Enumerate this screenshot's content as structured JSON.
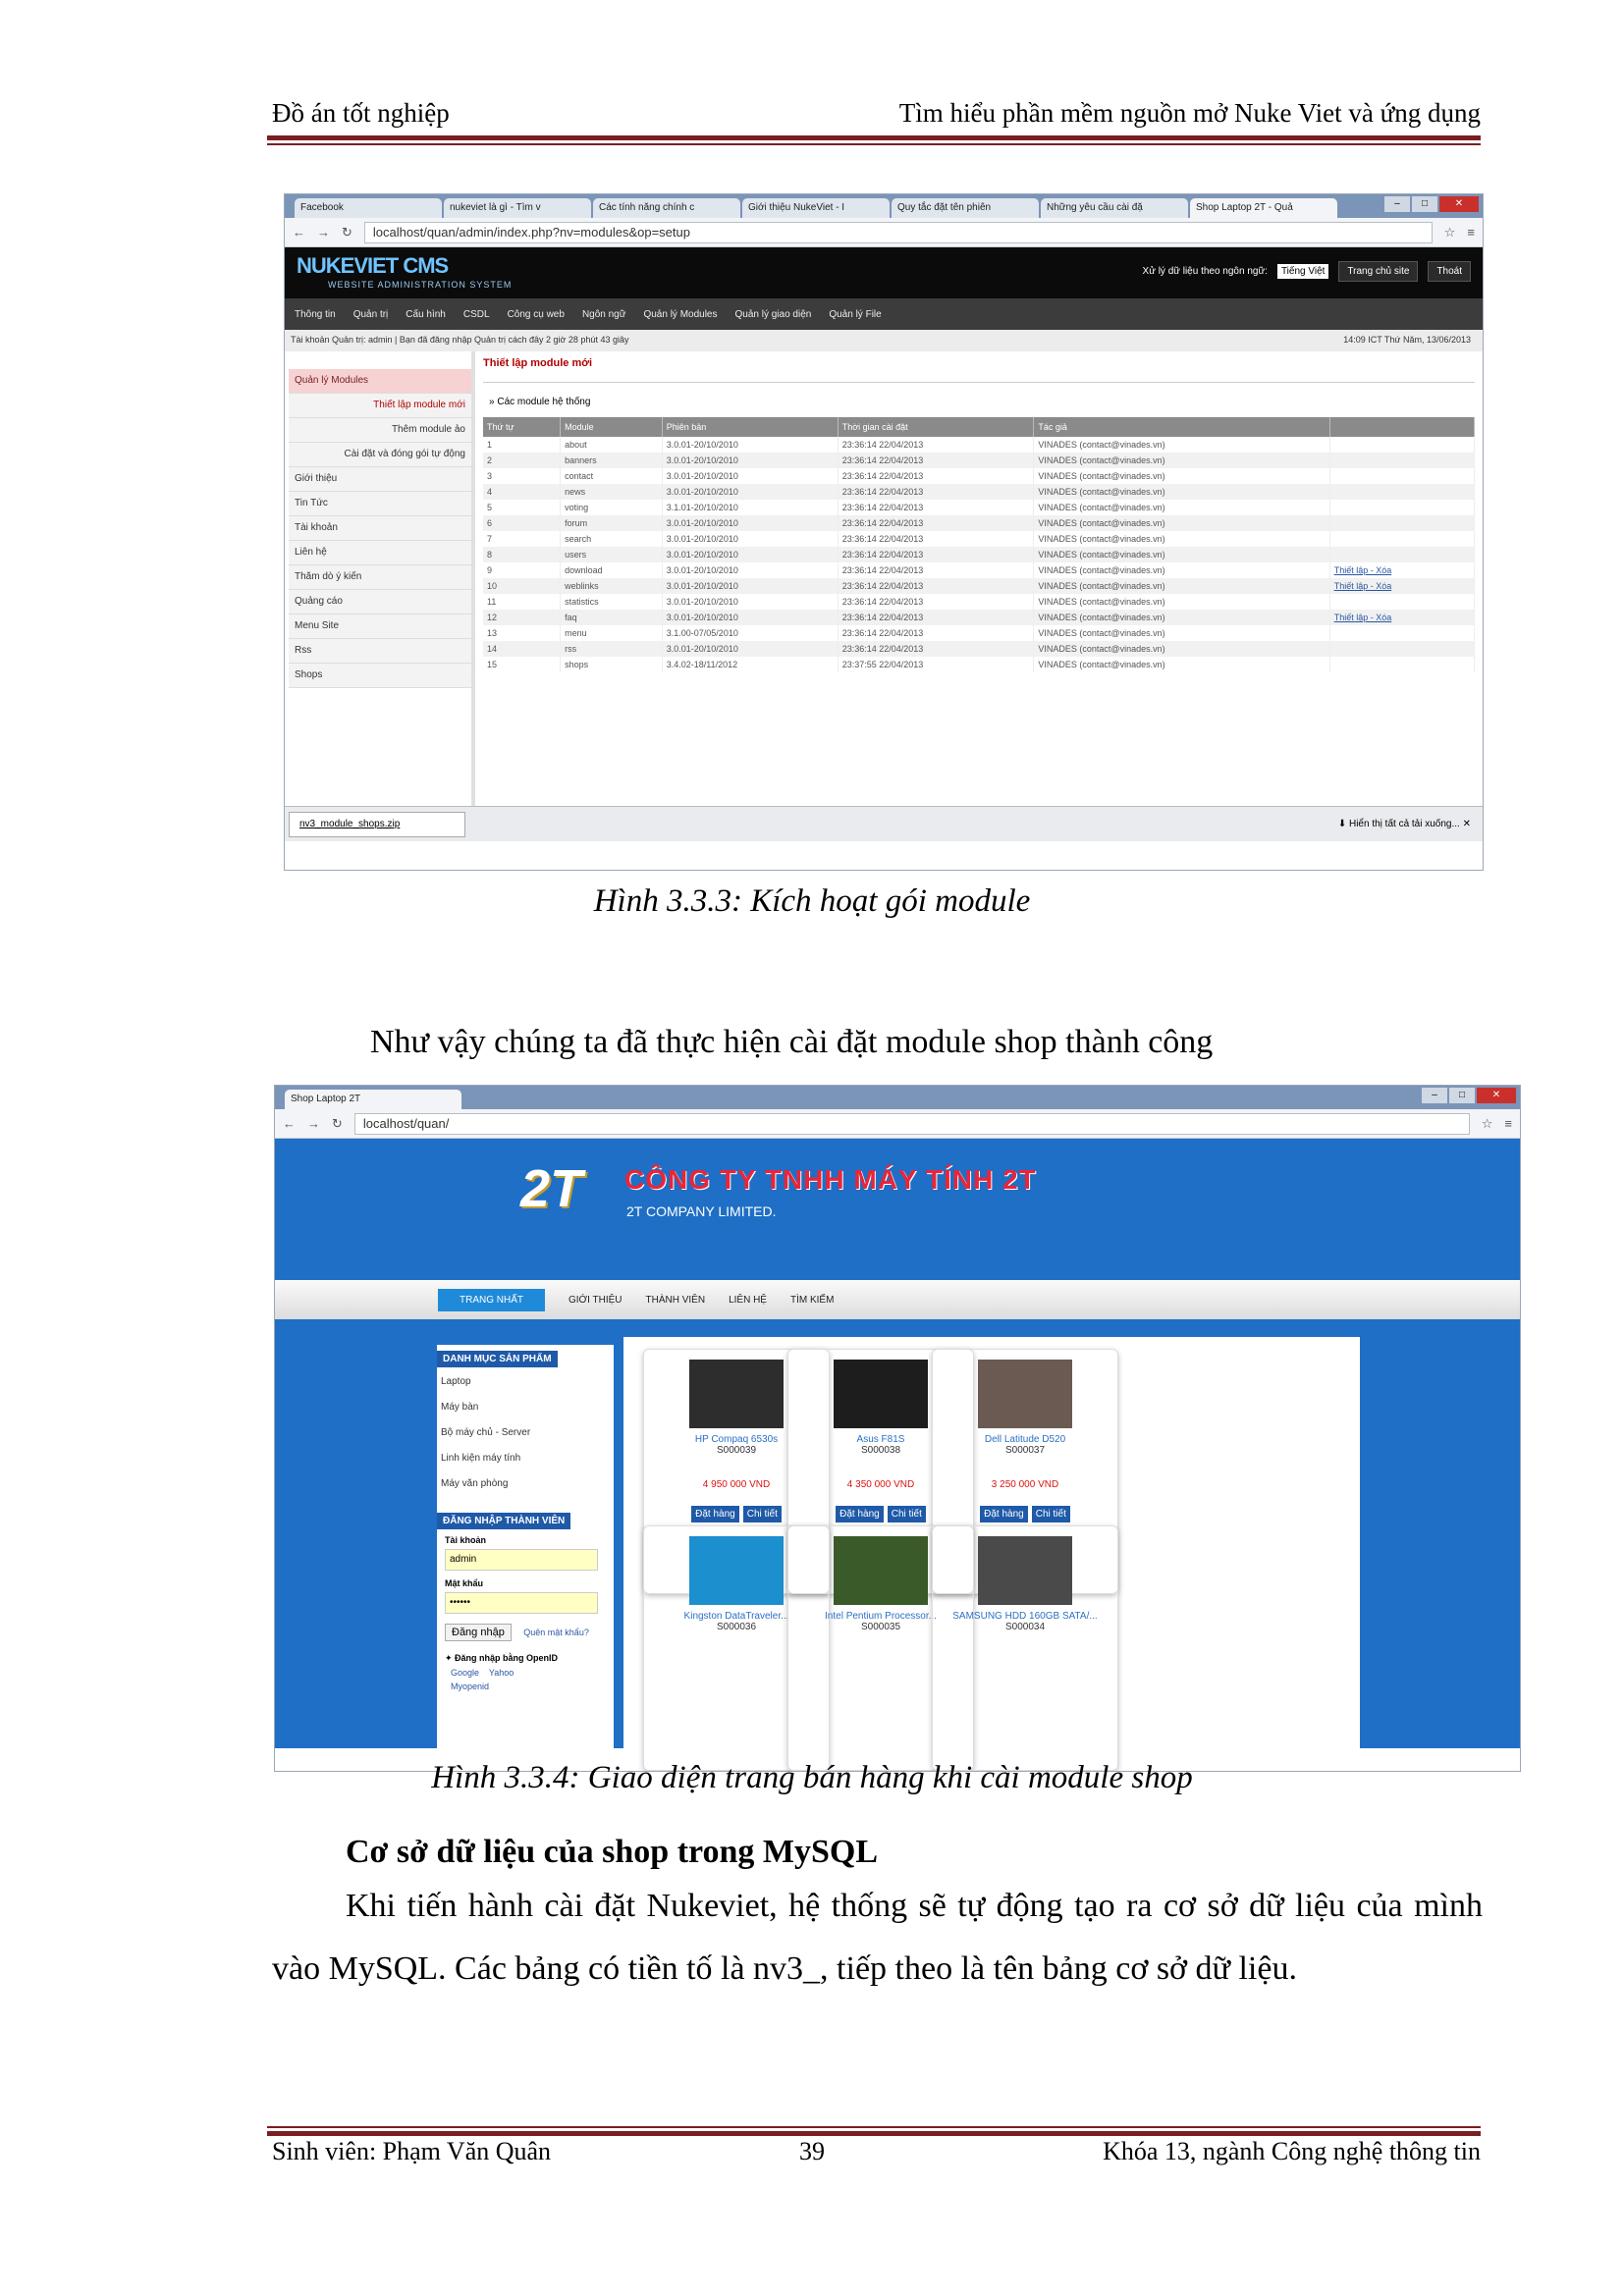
{
  "header": {
    "left": "Đồ án tốt nghiệp",
    "right": "Tìm hiểu phần mềm nguồn mở Nuke Viet và ứng dụng"
  },
  "fig1": {
    "tabs": [
      "Facebook",
      "nukeviet là gì - Tìm v",
      "Các tính năng chính c",
      "Giới thiệu NukeViet - I",
      "Quy tắc đặt tên phiên",
      "Những yêu cầu cài đặ",
      "Shop Laptop 2T - Quả"
    ],
    "url": "localhost/quan/admin/index.php?nv=modules&op=setup",
    "logo": "NUKEVIET CMS",
    "logo_sub": "WEBSITE ADMINISTRATION SYSTEM",
    "lang_label": "Xử lý dữ liệu theo ngôn ngữ:",
    "lang_value": "Tiếng Việt",
    "btn_home": "Trang chủ site",
    "btn_logout": "Thoát",
    "menu": [
      "Thông tin",
      "Quản trị",
      "Cấu hình",
      "CSDL",
      "Công cụ web",
      "Ngôn ngữ",
      "Quản lý Modules",
      "Quản lý giao diện",
      "Quản lý File"
    ],
    "info_left": "Tài khoản Quản trị: admin | Bạn đã đăng nhập Quản trị cách đây 2 giờ 28 phút 43 giây",
    "info_right": "14:09 ICT  Thứ Năm, 13/06/2013",
    "side": [
      {
        "label": "Quản lý Modules",
        "kind": "head"
      },
      {
        "label": "Thiết lập module mới",
        "kind": "sub on"
      },
      {
        "label": "Thêm module ảo",
        "kind": "sub"
      },
      {
        "label": "Cài đặt và đóng gói tự động",
        "kind": "sub"
      },
      {
        "label": "Giới thiệu",
        "kind": ""
      },
      {
        "label": "Tin Tức",
        "kind": ""
      },
      {
        "label": "Tài khoản",
        "kind": ""
      },
      {
        "label": "Liên hệ",
        "kind": ""
      },
      {
        "label": "Thăm dò ý kiến",
        "kind": ""
      },
      {
        "label": "Quảng cáo",
        "kind": ""
      },
      {
        "label": "Menu Site",
        "kind": ""
      },
      {
        "label": "Rss",
        "kind": ""
      },
      {
        "label": "Shops",
        "kind": ""
      }
    ],
    "main_title": "Thiết lập module mới",
    "section_title": "Các module hệ thống",
    "columns": [
      "Thứ tự",
      "Module",
      "Phiên bản",
      "Thời gian cài đặt",
      "Tác giả",
      ""
    ],
    "rows": [
      [
        "1",
        "about",
        "3.0.01-20/10/2010",
        "23:36:14 22/04/2013",
        "VINADES (contact@vinades.vn)",
        ""
      ],
      [
        "2",
        "banners",
        "3.0.01-20/10/2010",
        "23:36:14 22/04/2013",
        "VINADES (contact@vinades.vn)",
        ""
      ],
      [
        "3",
        "contact",
        "3.0.01-20/10/2010",
        "23:36:14 22/04/2013",
        "VINADES (contact@vinades.vn)",
        ""
      ],
      [
        "4",
        "news",
        "3.0.01-20/10/2010",
        "23:36:14 22/04/2013",
        "VINADES (contact@vinades.vn)",
        ""
      ],
      [
        "5",
        "voting",
        "3.1.01-20/10/2010",
        "23:36:14 22/04/2013",
        "VINADES (contact@vinades.vn)",
        ""
      ],
      [
        "6",
        "forum",
        "3.0.01-20/10/2010",
        "23:36:14 22/04/2013",
        "VINADES (contact@vinades.vn)",
        ""
      ],
      [
        "7",
        "search",
        "3.0.01-20/10/2010",
        "23:36:14 22/04/2013",
        "VINADES (contact@vinades.vn)",
        ""
      ],
      [
        "8",
        "users",
        "3.0.01-20/10/2010",
        "23:36:14 22/04/2013",
        "VINADES (contact@vinades.vn)",
        ""
      ],
      [
        "9",
        "download",
        "3.0.01-20/10/2010",
        "23:36:14 22/04/2013",
        "VINADES (contact@vinades.vn)",
        "Thiết lập - Xóa"
      ],
      [
        "10",
        "weblinks",
        "3.0.01-20/10/2010",
        "23:36:14 22/04/2013",
        "VINADES (contact@vinades.vn)",
        "Thiết lập - Xóa"
      ],
      [
        "11",
        "statistics",
        "3.0.01-20/10/2010",
        "23:36:14 22/04/2013",
        "VINADES (contact@vinades.vn)",
        ""
      ],
      [
        "12",
        "faq",
        "3.0.01-20/10/2010",
        "23:36:14 22/04/2013",
        "VINADES (contact@vinades.vn)",
        "Thiết lập - Xóa"
      ],
      [
        "13",
        "menu",
        "3.1.00-07/05/2010",
        "23:36:14 22/04/2013",
        "VINADES (contact@vinades.vn)",
        ""
      ],
      [
        "14",
        "rss",
        "3.0.01-20/10/2010",
        "23:36:14 22/04/2013",
        "VINADES (contact@vinades.vn)",
        ""
      ],
      [
        "15",
        "shops",
        "3.4.02-18/11/2012",
        "23:37:55 22/04/2013",
        "VINADES (contact@vinades.vn)",
        ""
      ]
    ],
    "download_file": "nv3_module_shops.zip",
    "download_all": "Hiển thị tất cả tải xuống..."
  },
  "caption1": "Hình 3.3.3: Kích hoạt gói module",
  "para1": "Như vậy chúng ta đã thực hiện cài đặt module shop thành công",
  "fig2": {
    "tab": "Shop Laptop 2T",
    "url": "localhost/quan/",
    "logo": "2T",
    "company": "CÔNG TY TNHH MÁY TÍNH 2T",
    "company_en": "2T COMPANY LIMITED.",
    "nav": [
      "TRANG NHẤT",
      "GIỚI THIỆU",
      "THÀNH VIÊN",
      "LIÊN HỆ",
      "TÌM KIẾM"
    ],
    "cat_title": "DANH MỤC SẢN PHẨM",
    "categories": [
      "Laptop",
      "Máy bàn",
      "Bộ máy chủ - Server",
      "Linh kiện máy tính",
      "Máy văn phòng"
    ],
    "login_title": "ĐĂNG NHẬP THÀNH VIÊN",
    "user_label": "Tài khoản",
    "user_value": "admin",
    "pass_label": "Mật khẩu",
    "pass_value": "••••••",
    "login_btn": "Đăng nhập",
    "forgot": "Quên mật khẩu?",
    "openid": "Đăng nhập bằng OpenID",
    "openid_providers": [
      "Google",
      "Yahoo",
      "Myopenid"
    ],
    "products": [
      {
        "name": "HP Compaq 6530s",
        "code": "S000039",
        "price": "4 950 000 VND"
      },
      {
        "name": "Asus F81S",
        "code": "S000038",
        "price": "4 350 000 VND"
      },
      {
        "name": "Dell Latitude D520",
        "code": "S000037",
        "price": "3 250 000 VND"
      },
      {
        "name": "Kingston DataTraveler...",
        "code": "S000036",
        "price": ""
      },
      {
        "name": "Intel Pentium Processor...",
        "code": "S000035",
        "price": ""
      },
      {
        "name": "SAMSUNG HDD 160GB SATA/...",
        "code": "S000034",
        "price": ""
      }
    ],
    "btn_order": "Đặt hàng",
    "btn_detail": "Chi tiết"
  },
  "caption2": "Hình 3.3.4: Giao diện trang bán hàng khi cài module shop",
  "heading": "Cơ sở dữ liệu của shop trong MySQL",
  "para2": "Khi tiến hành cài đặt Nukeviet, hệ thống sẽ tự động tạo ra cơ sở dữ liệu của mình vào MySQL. Các bảng có tiền tố là nv3_, tiếp theo là tên bảng cơ sở dữ liệu.",
  "footer": {
    "left": "Sinh viên: Phạm Văn Quân",
    "page": "39",
    "right": "Khóa 13, ngành Công nghệ thông tin"
  }
}
